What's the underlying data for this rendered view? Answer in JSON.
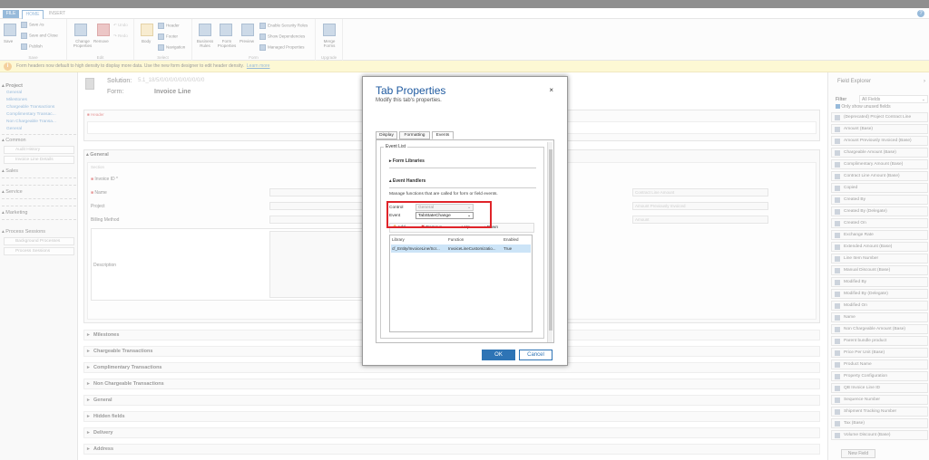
{
  "ribbon": {
    "tabs": [
      "FILE",
      "HOME",
      "INSERT"
    ],
    "help": "?",
    "groups": {
      "save": {
        "label": "Save",
        "save": "Save",
        "save_as": "Save As",
        "save_close": "Save and Close",
        "publish": "Publish"
      },
      "edit": {
        "label": "Edit",
        "change_props": "Change Properties",
        "remove": "Remove",
        "undo": "Undo",
        "redo": "Redo"
      },
      "select": {
        "label": "Select",
        "body": "Body",
        "header": "Header",
        "footer": "Footer",
        "navigation": "Navigation"
      },
      "form": {
        "label": "Form",
        "business_rules": "Business Rules",
        "form_properties": "Form Properties",
        "preview": "Preview",
        "enable_security": "Enable Security Roles",
        "show_deps": "Show Dependencies",
        "managed_props": "Managed Properties"
      },
      "upgrade": {
        "label": "Upgrade",
        "merge_forms": "Merge Forms"
      }
    }
  },
  "notification": {
    "text": "Form headers now default to high density to display more data. Use the new form designer to edit header density.",
    "link": "Learn more"
  },
  "nav": {
    "project": "Project",
    "project_items": [
      "General",
      "Milestones",
      "Chargeable Transactions",
      "Complimentary Transac...",
      "Non Chargeable Transa...",
      "General"
    ],
    "common": "Common",
    "common_items": [
      "Audit History",
      "Invoice Line Details"
    ],
    "sales": "Sales",
    "service": "Service",
    "marketing": "Marketing",
    "process": "Process Sessions",
    "process_items": [
      "Background Processes",
      "Process Sessions"
    ]
  },
  "canvas": {
    "solution_label": "Solution:",
    "solution_value": "5.1_18/5/0/0/0/0/0/0/0/0/0/0",
    "form_label": "Form:",
    "form_value": "Invoice Line",
    "header": "Header",
    "general": "General",
    "section": "Section",
    "fields": {
      "invoice_id": "Invoice ID",
      "name": "Name",
      "project": "Project",
      "billing_method": "Billing Method",
      "description": "Description"
    },
    "right_fields": [
      "Contract Line Amount",
      "Amount Previously Invoiced",
      "Amount"
    ],
    "collapsed": [
      "Milestones",
      "Chargeable Transactions",
      "Complimentary Transactions",
      "Non Chargeable Transactions",
      "General",
      "Hidden fields",
      "Delivery",
      "Address"
    ]
  },
  "field_explorer": {
    "title": "Field Explorer",
    "filter_label": "Filter",
    "filter_value": "All Fields",
    "only_unused": "Only show unused fields",
    "fields": [
      "(Deprecated) Project Contract Line",
      "Amount (Base)",
      "Amount Previously Invoiced (Base)",
      "Chargeable Amount (Base)",
      "Complimentary Amount (Base)",
      "Contract Line Amount (Base)",
      "Copied",
      "Created By",
      "Created By (Delegate)",
      "Created On",
      "Exchange Rate",
      "Extended Amount (Base)",
      "Line Item Number",
      "Manual Discount (Base)",
      "Modified By",
      "Modified By (Delegate)",
      "Modified On",
      "Name",
      "Non Chargeable Amount (Base)",
      "Parent bundle product",
      "Price Per Unit (Base)",
      "Product Name",
      "Property Configuration",
      "QB Invoice Line ID",
      "Sequence Number",
      "Shipment Tracking Number",
      "Tax (Base)",
      "Volume Discount (Base)"
    ],
    "new_field": "New Field"
  },
  "dialog": {
    "title": "Tab Properties",
    "subtitle": "Modify this tab's properties.",
    "close": "×",
    "tabs": [
      "Display",
      "Formatting",
      "Events"
    ],
    "event_list": "Event List",
    "form_libraries": "Form Libraries",
    "event_handlers": "Event Handlers",
    "handlers_desc": "Manage functions that are called for form or field events.",
    "control_label": "Control",
    "control_value": "General",
    "event_label": "Event",
    "event_value": "TabStateChange",
    "toolbar": {
      "add": "Add",
      "remove": "Remove",
      "up": "Up",
      "down": "Down"
    },
    "table_headers": [
      "Library",
      "Function",
      "Enabled"
    ],
    "table_row": [
      "cf_Entity/InvoiceLine/Scr...",
      "InvoiceLineCustomizatio...",
      "True"
    ],
    "ok": "OK",
    "cancel": "Cancel"
  }
}
